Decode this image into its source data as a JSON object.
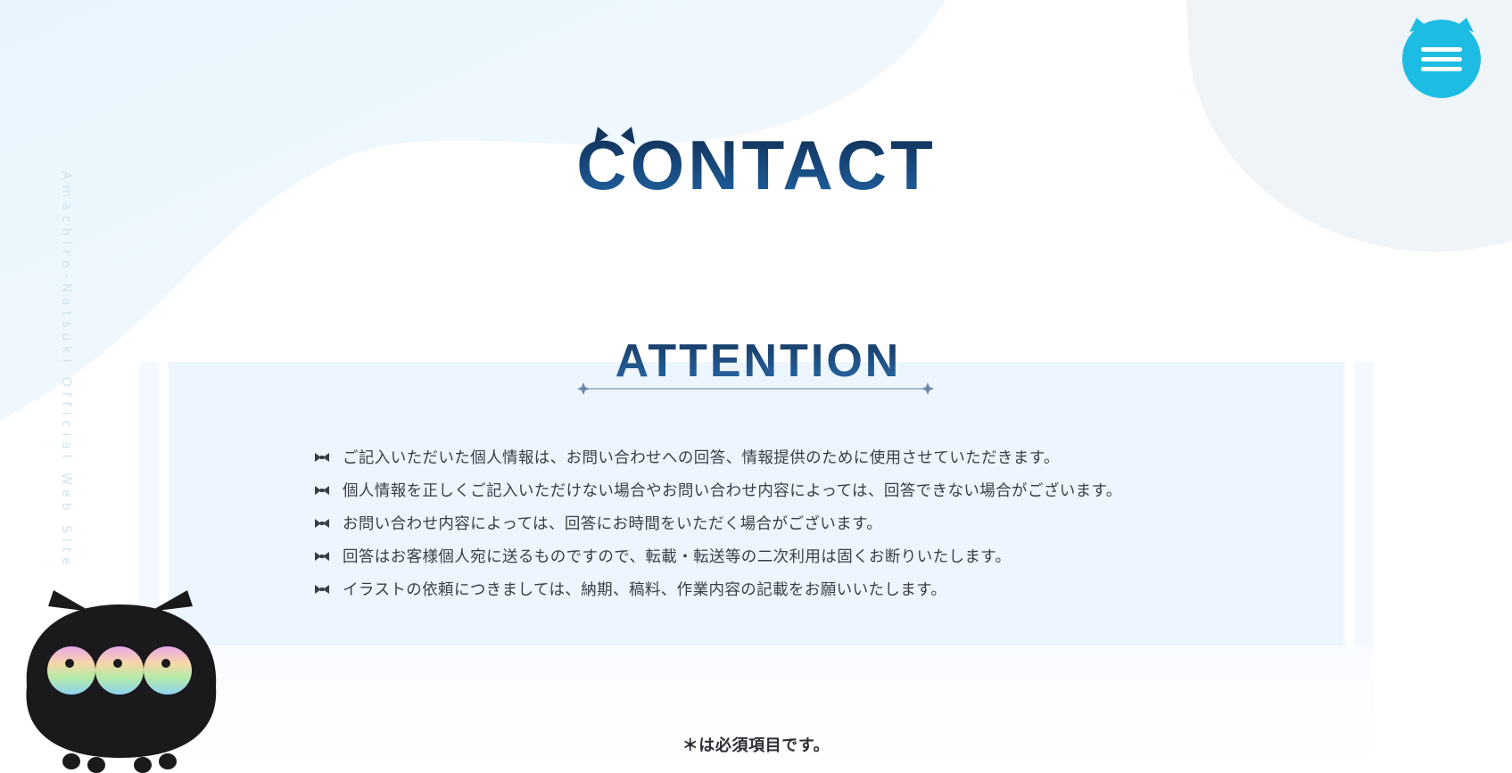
{
  "site": {
    "vertical_label": "Amachiro-Natsuki Official Web Site"
  },
  "header": {
    "menu_icon": "hamburger-icon",
    "title": "CONTACT"
  },
  "attention": {
    "title": "ATTENTION",
    "bullet_icon": "bow-icon",
    "items": [
      "ご記入いただいた個人情報は、お問い合わせへの回答、情報提供のために使用させていただきます。",
      "個人情報を正しくご記入いただけない場合やお問い合わせ内容によっては、回答できない場合がございます。",
      "お問い合わせ内容によっては、回答にお時間をいただく場合がございます。",
      "回答はお客様個人宛に送るものですので、転載・転送等の二次利用は固くお断りいたします。",
      "イラストの依頼につきましては、納期、稿料、作業内容の記載をお願いいたします。"
    ]
  },
  "form": {
    "required_note": "＊は必須項目です。"
  },
  "colors": {
    "accent_cyan": "#1dbde3",
    "title_navy": "#14365e",
    "title_blue": "#1e5a96",
    "panel_bg": "#edf5fe",
    "body_text": "#3a3f47"
  }
}
